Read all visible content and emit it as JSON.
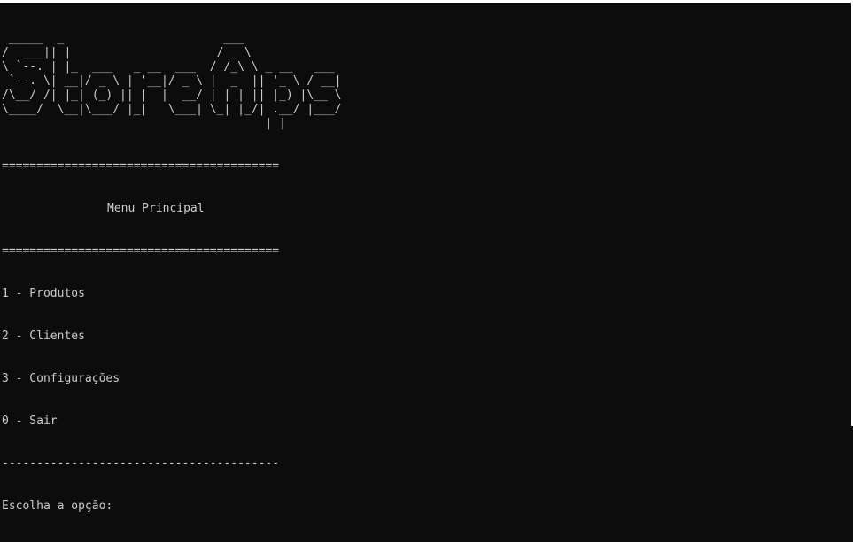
{
  "terminal": {
    "ascii_logo": [
      " _____  _                       ___             ",
      "/  ___|| |                     / _ \\            ",
      "\\ `--. | |_  ___   _ __  ___  / /_\\ \\ _ __   ___ ",
      " `--. \\| __|/ _ \\ | '__|/ _ \\ |  _  || '_ \\ / __|",
      "/\\__/ /| |_| (_) || |  |  __/ | | | || |_) |\\__ \\",
      "\\____/  \\__|\\___/ |_|   \\___| \\_| |_/| .__/ |___/",
      "                                      | |        ",
      "                                      |_|        "
    ],
    "separator_double": "========================================",
    "menu_title": "Menu Principal",
    "options": [
      "1 - Produtos",
      "2 - Clientes",
      "3 - Configurações",
      "0 - Sair"
    ],
    "separator_single": "----------------------------------------",
    "prompt": "Escolha a opção:"
  },
  "colors": {
    "background": "#0c0c0c",
    "foreground": "#cccccc"
  }
}
